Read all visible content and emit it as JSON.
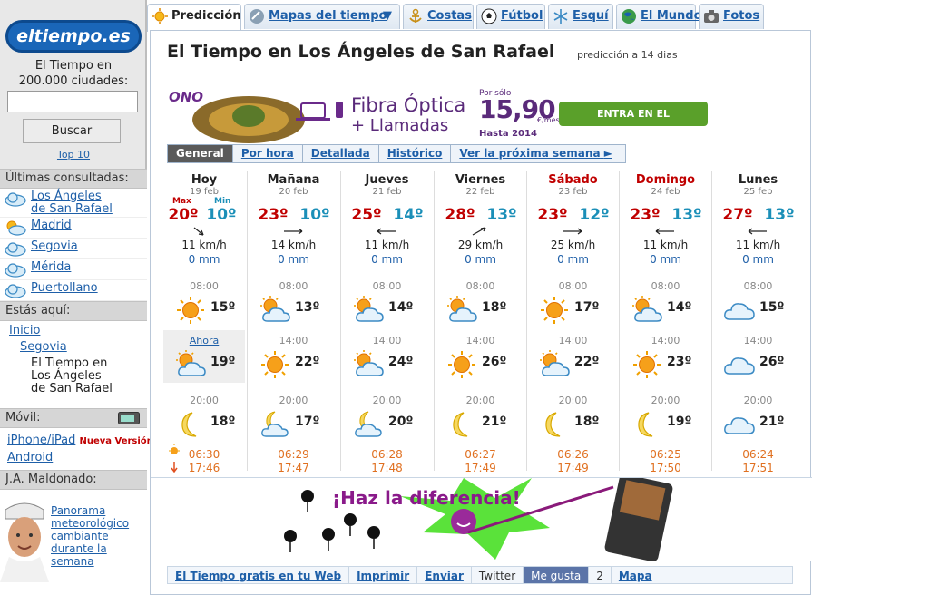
{
  "sidebar": {
    "logo_text": "eltiempo.es",
    "tagline_line1": "El Tiempo en",
    "tagline_line2": "200.000 ciudades:",
    "search_button": "Buscar",
    "top10": "Top 10",
    "recent_header": "Últimas consultadas:",
    "recent": [
      {
        "label1": "Los Ángeles",
        "label2": "de San Rafael",
        "icon": "cloud-icon"
      },
      {
        "label1": "Madrid",
        "label2": "",
        "icon": "sun-cloud-icon"
      },
      {
        "label1": "Segovia",
        "label2": "",
        "icon": "cloud-icon"
      },
      {
        "label1": "Mérida",
        "label2": "",
        "icon": "cloud-icon"
      },
      {
        "label1": "Puertollano",
        "label2": "",
        "icon": "cloud-icon"
      }
    ],
    "here_header": "Estás aquí:",
    "crumbs": {
      "home": "Inicio",
      "region": "Segovia",
      "current1": "El Tiempo en",
      "current2": "Los Ángeles",
      "current3": "de San Rafael"
    },
    "mobile_header": "Móvil:",
    "mobile_iphone": "iPhone/iPad",
    "mobile_new": "Nueva Versión",
    "mobile_android": "Android",
    "author_header": "J.A. Maldonado:",
    "author_link1": "Panorama",
    "author_link2": "meteorológico",
    "author_link3": "cambiante",
    "author_link4": "durante la",
    "author_link5": "semana"
  },
  "tabs": [
    {
      "label": "Predicción",
      "icon": "sun-icon",
      "active": true
    },
    {
      "label": "Mapas del tiempo",
      "icon": "satellite-icon"
    },
    {
      "label": "Costas",
      "icon": "anchor-icon"
    },
    {
      "label": "Fútbol",
      "icon": "football-icon"
    },
    {
      "label": "Esquí",
      "icon": "snowflake-icon"
    },
    {
      "label": "El Mundo",
      "icon": "globe-icon"
    },
    {
      "label": "Fotos",
      "icon": "camera-icon"
    }
  ],
  "main": {
    "title": "El Tiempo en Los Ángeles de San Rafael",
    "subtitle": "predicción a 14 dias",
    "ad": {
      "brand": "ONO",
      "line1": "Fibra Óptica",
      "line2": "+ Llamadas",
      "price_prefix": "Por sólo",
      "price": "15,90",
      "price_unit": "€/mes",
      "until": "Hasta 2014",
      "cta": "ENTRA EN EL TORTUGADOR"
    },
    "subtabs": [
      "General",
      "Por hora",
      "Detallada",
      "Histórico",
      "Ver la próxima semana"
    ],
    "max_label": "Max",
    "min_label": "Min",
    "ahora": "Ahora",
    "days": [
      {
        "name": "Hoy",
        "date": "19 feb",
        "max": "20º",
        "min": "10º",
        "speed": "11 km/h",
        "rain": "0 mm",
        "t1": "08:00",
        "v1": "15º",
        "t2": "",
        "v2": "19º",
        "t3": "20:00",
        "v3": "18º",
        "sunrise": "06:30",
        "sunset": "17:46"
      },
      {
        "name": "Mañana",
        "date": "20 feb",
        "max": "23º",
        "min": "10º",
        "speed": "14 km/h",
        "rain": "0 mm",
        "t1": "08:00",
        "v1": "13º",
        "t2": "14:00",
        "v2": "22º",
        "t3": "20:00",
        "v3": "17º",
        "sunrise": "06:29",
        "sunset": "17:47"
      },
      {
        "name": "Jueves",
        "date": "21 feb",
        "max": "25º",
        "min": "14º",
        "speed": "11 km/h",
        "rain": "0 mm",
        "t1": "08:00",
        "v1": "14º",
        "t2": "14:00",
        "v2": "24º",
        "t3": "20:00",
        "v3": "20º",
        "sunrise": "06:28",
        "sunset": "17:48"
      },
      {
        "name": "Viernes",
        "date": "22 feb",
        "max": "28º",
        "min": "13º",
        "speed": "29 km/h",
        "rain": "0 mm",
        "t1": "08:00",
        "v1": "18º",
        "t2": "14:00",
        "v2": "26º",
        "t3": "20:00",
        "v3": "21º",
        "sunrise": "06:27",
        "sunset": "17:49"
      },
      {
        "name": "Sábado",
        "date": "23 feb",
        "max": "23º",
        "min": "12º",
        "speed": "25 km/h",
        "rain": "0 mm",
        "t1": "08:00",
        "v1": "17º",
        "t2": "14:00",
        "v2": "22º",
        "t3": "20:00",
        "v3": "18º",
        "sunrise": "06:26",
        "sunset": "17:49"
      },
      {
        "name": "Domingo",
        "date": "24 feb",
        "max": "23º",
        "min": "13º",
        "speed": "11 km/h",
        "rain": "0 mm",
        "t1": "08:00",
        "v1": "14º",
        "t2": "14:00",
        "v2": "23º",
        "t3": "20:00",
        "v3": "19º",
        "sunrise": "06:25",
        "sunset": "17:50"
      },
      {
        "name": "Lunes",
        "date": "25 feb",
        "max": "27º",
        "min": "13º",
        "speed": "11 km/h",
        "rain": "0 mm",
        "t1": "08:00",
        "v1": "15º",
        "t2": "14:00",
        "v2": "26º",
        "t3": "20:00",
        "v3": "21º",
        "sunrise": "06:24",
        "sunset": "17:51"
      }
    ],
    "bottom_ad": {
      "slogan": "¡Haz la diferencia!"
    },
    "footer": [
      "El Tiempo gratis en tu Web",
      "Imprimir",
      "Enviar",
      "Twitter",
      "Me gusta",
      "2",
      "Mapa"
    ]
  }
}
